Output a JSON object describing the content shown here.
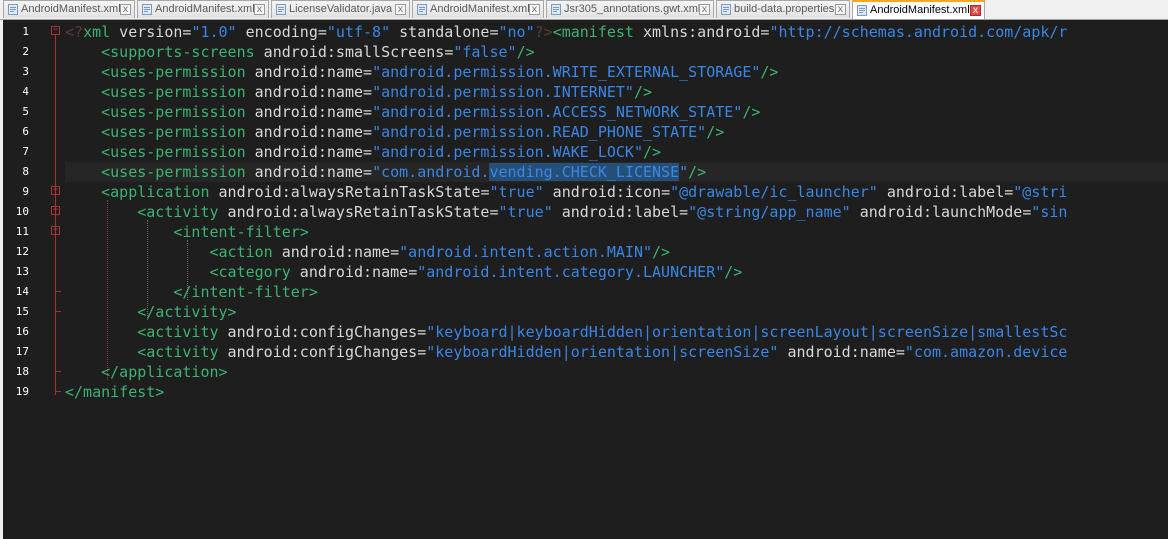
{
  "tabs": [
    {
      "label": "AndroidManifest.xml",
      "active": false
    },
    {
      "label": "AndroidManifest.xml",
      "active": false
    },
    {
      "label": "LicenseValidator.java",
      "active": false
    },
    {
      "label": "AndroidManifest.xml",
      "active": false
    },
    {
      "label": "Jsr305_annotations.gwt.xml",
      "active": false
    },
    {
      "label": "build-data.properties",
      "active": false
    },
    {
      "label": "AndroidManifest.xml",
      "active": true
    }
  ],
  "close_glyph": "x",
  "colors": {
    "accent": "#f9a81b",
    "tag": "#3cb371",
    "value": "#3a86e6",
    "attribute": "#d8d8d8",
    "background": "#1e1e1e"
  },
  "editor": {
    "current_line": 8,
    "lines": [
      {
        "n": "1",
        "tokens": [
          [
            "pi",
            "<?"
          ],
          [
            "tag",
            "xml"
          ],
          [
            "attr",
            " version"
          ],
          [
            "txt",
            "="
          ],
          [
            "val",
            "\"1.0\""
          ],
          [
            "attr",
            " encoding"
          ],
          [
            "txt",
            "="
          ],
          [
            "val",
            "\"utf-8\""
          ],
          [
            "attr",
            " standalone"
          ],
          [
            "txt",
            "="
          ],
          [
            "val",
            "\"no\""
          ],
          [
            "pi",
            "?>"
          ],
          [
            "tag",
            "<manifest"
          ],
          [
            "attr",
            " xmlns:android"
          ],
          [
            "txt",
            "="
          ],
          [
            "val",
            "\"http://schemas.android.com/apk/r"
          ]
        ]
      },
      {
        "n": "2",
        "tokens": [
          [
            "txt",
            "    "
          ],
          [
            "tag",
            "<supports-screens"
          ],
          [
            "attr",
            " android:smallScreens"
          ],
          [
            "txt",
            "="
          ],
          [
            "val",
            "\"false\""
          ],
          [
            "tag",
            "/>"
          ]
        ]
      },
      {
        "n": "3",
        "tokens": [
          [
            "txt",
            "    "
          ],
          [
            "tag",
            "<uses-permission"
          ],
          [
            "attr",
            " android:name"
          ],
          [
            "txt",
            "="
          ],
          [
            "val",
            "\"android.permission.WRITE_EXTERNAL_STORAGE\""
          ],
          [
            "tag",
            "/>"
          ]
        ]
      },
      {
        "n": "4",
        "tokens": [
          [
            "txt",
            "    "
          ],
          [
            "tag",
            "<uses-permission"
          ],
          [
            "attr",
            " android:name"
          ],
          [
            "txt",
            "="
          ],
          [
            "val",
            "\"android.permission.INTERNET\""
          ],
          [
            "tag",
            "/>"
          ]
        ]
      },
      {
        "n": "5",
        "tokens": [
          [
            "txt",
            "    "
          ],
          [
            "tag",
            "<uses-permission"
          ],
          [
            "attr",
            " android:name"
          ],
          [
            "txt",
            "="
          ],
          [
            "val",
            "\"android.permission.ACCESS_NETWORK_STATE\""
          ],
          [
            "tag",
            "/>"
          ]
        ]
      },
      {
        "n": "6",
        "tokens": [
          [
            "txt",
            "    "
          ],
          [
            "tag",
            "<uses-permission"
          ],
          [
            "attr",
            " android:name"
          ],
          [
            "txt",
            "="
          ],
          [
            "val",
            "\"android.permission.READ_PHONE_STATE\""
          ],
          [
            "tag",
            "/>"
          ]
        ]
      },
      {
        "n": "7",
        "tokens": [
          [
            "txt",
            "    "
          ],
          [
            "tag",
            "<uses-permission"
          ],
          [
            "attr",
            " android:name"
          ],
          [
            "txt",
            "="
          ],
          [
            "val",
            "\"android.permission.WAKE_LOCK\""
          ],
          [
            "tag",
            "/>"
          ]
        ]
      },
      {
        "n": "8",
        "tokens": [
          [
            "txt",
            "    "
          ],
          [
            "tag",
            "<uses-permission"
          ],
          [
            "attr",
            " android:name"
          ],
          [
            "txt",
            "="
          ],
          [
            "val",
            "\"com.android."
          ],
          [
            "sel",
            "vending.CHECK_LICENSE"
          ],
          [
            "val",
            "\""
          ],
          [
            "tag",
            "/>"
          ]
        ]
      },
      {
        "n": "9",
        "tokens": [
          [
            "txt",
            "    "
          ],
          [
            "tag",
            "<application"
          ],
          [
            "attr",
            " android:alwaysRetainTaskState"
          ],
          [
            "txt",
            "="
          ],
          [
            "val",
            "\"true\""
          ],
          [
            "attr",
            " android:icon"
          ],
          [
            "txt",
            "="
          ],
          [
            "val",
            "\"@drawable/ic_launcher\""
          ],
          [
            "attr",
            " android:label"
          ],
          [
            "txt",
            "="
          ],
          [
            "val",
            "\"@stri"
          ]
        ]
      },
      {
        "n": "10",
        "tokens": [
          [
            "txt",
            "        "
          ],
          [
            "tag",
            "<activity"
          ],
          [
            "attr",
            " android:alwaysRetainTaskState"
          ],
          [
            "txt",
            "="
          ],
          [
            "val",
            "\"true\""
          ],
          [
            "attr",
            " android:label"
          ],
          [
            "txt",
            "="
          ],
          [
            "val",
            "\"@string/app_name\""
          ],
          [
            "attr",
            " android:launchMode"
          ],
          [
            "txt",
            "="
          ],
          [
            "val",
            "\"sin"
          ]
        ]
      },
      {
        "n": "11",
        "tokens": [
          [
            "txt",
            "            "
          ],
          [
            "tag",
            "<intent-filter>"
          ]
        ]
      },
      {
        "n": "12",
        "tokens": [
          [
            "txt",
            "                "
          ],
          [
            "tag",
            "<action"
          ],
          [
            "attr",
            " android:name"
          ],
          [
            "txt",
            "="
          ],
          [
            "val",
            "\"android.intent.action.MAIN\""
          ],
          [
            "tag",
            "/>"
          ]
        ]
      },
      {
        "n": "13",
        "tokens": [
          [
            "txt",
            "                "
          ],
          [
            "tag",
            "<category"
          ],
          [
            "attr",
            " android:name"
          ],
          [
            "txt",
            "="
          ],
          [
            "val",
            "\"android.intent.category.LAUNCHER\""
          ],
          [
            "tag",
            "/>"
          ]
        ]
      },
      {
        "n": "14",
        "tokens": [
          [
            "txt",
            "            "
          ],
          [
            "tag",
            "</intent-filter>"
          ]
        ]
      },
      {
        "n": "15",
        "tokens": [
          [
            "txt",
            "        "
          ],
          [
            "tag",
            "</activity>"
          ]
        ]
      },
      {
        "n": "16",
        "tokens": [
          [
            "txt",
            "        "
          ],
          [
            "tag",
            "<activity"
          ],
          [
            "attr",
            " android:configChanges"
          ],
          [
            "txt",
            "="
          ],
          [
            "val",
            "\"keyboard|keyboardHidden|orientation|screenLayout|screenSize|smallestSc"
          ]
        ]
      },
      {
        "n": "17",
        "tokens": [
          [
            "txt",
            "        "
          ],
          [
            "tag",
            "<activity"
          ],
          [
            "attr",
            " android:configChanges"
          ],
          [
            "txt",
            "="
          ],
          [
            "val",
            "\"keyboardHidden|orientation|screenSize\""
          ],
          [
            "attr",
            " android:name"
          ],
          [
            "txt",
            "="
          ],
          [
            "val",
            "\"com.amazon.device"
          ]
        ]
      },
      {
        "n": "18",
        "tokens": [
          [
            "txt",
            "    "
          ],
          [
            "tag",
            "</application>"
          ]
        ]
      },
      {
        "n": "19",
        "tokens": [
          [
            "tag",
            "</manifest>"
          ]
        ]
      }
    ]
  }
}
